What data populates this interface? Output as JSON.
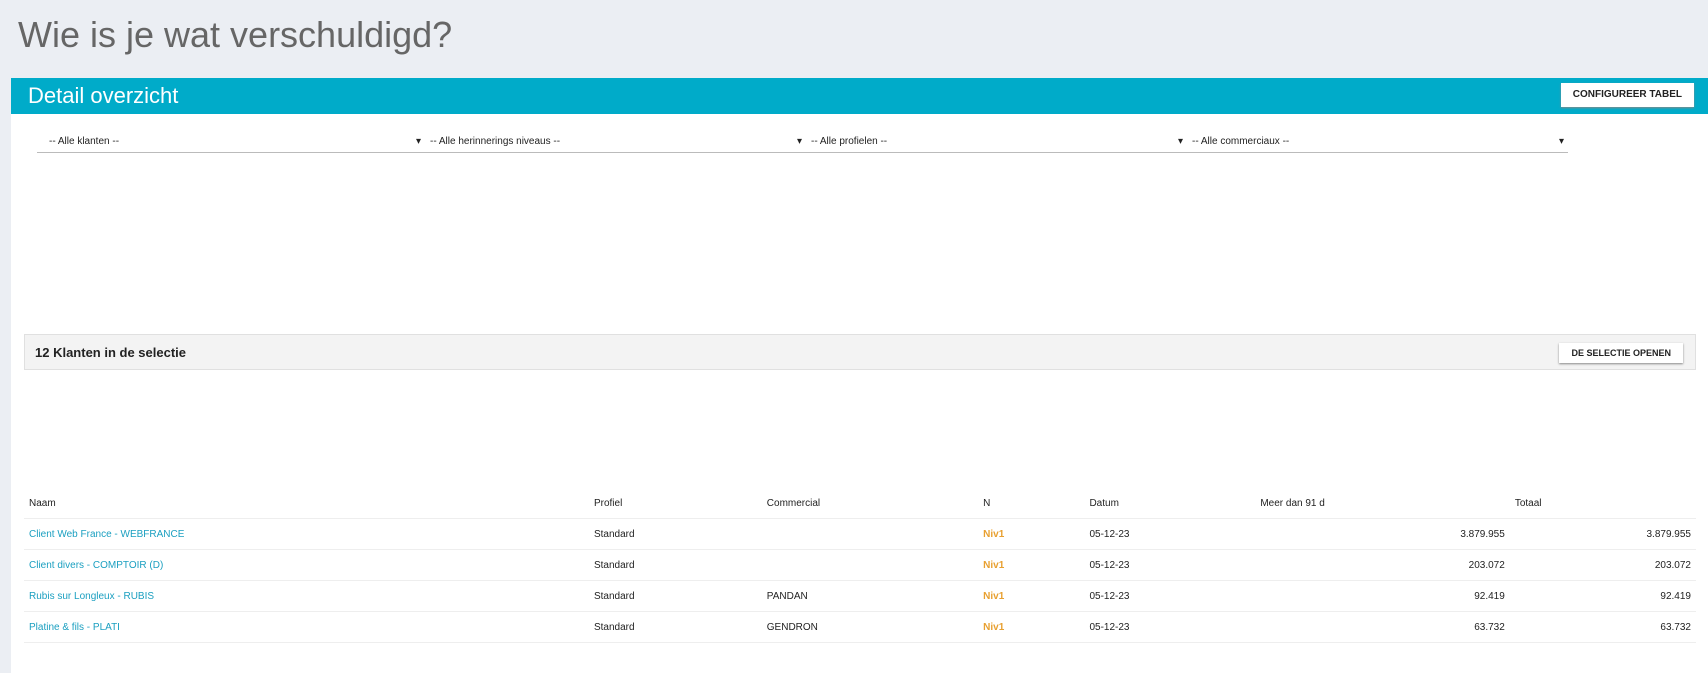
{
  "title": "Wie is je wat verschuldigd?",
  "panel": "Detail overzicht",
  "cfg": "CONFIGUREER TABEL",
  "filters": [
    "-- Alle klanten --",
    "-- Alle herinnerings niveaus --",
    "-- Alle profielen --",
    "-- Alle commerciaux --"
  ],
  "summary": "12 Klanten in de selectie",
  "open": "DE SELECTIE OPENEN",
  "headers": [
    "Naam",
    "Profiel",
    "Commercial",
    "N",
    "Datum",
    "Meer dan 91 d",
    "Totaal"
  ],
  "rows": [
    [
      "Client Web France - WEBFRANCE",
      "Standard",
      "",
      "Niv1",
      "05-12-23",
      "3.879.955",
      "3.879.955"
    ],
    [
      "Client divers - COMPTOIR (D)",
      "Standard",
      "",
      "Niv1",
      "05-12-23",
      "203.072",
      "203.072"
    ],
    [
      "Rubis sur Longleux - RUBIS",
      "Standard",
      "PANDAN",
      "Niv1",
      "05-12-23",
      "92.419",
      "92.419"
    ],
    [
      "Platine & fils - PLATI",
      "Standard",
      "GENDRON",
      "Niv1",
      "05-12-23",
      "63.732",
      "63.732"
    ]
  ]
}
